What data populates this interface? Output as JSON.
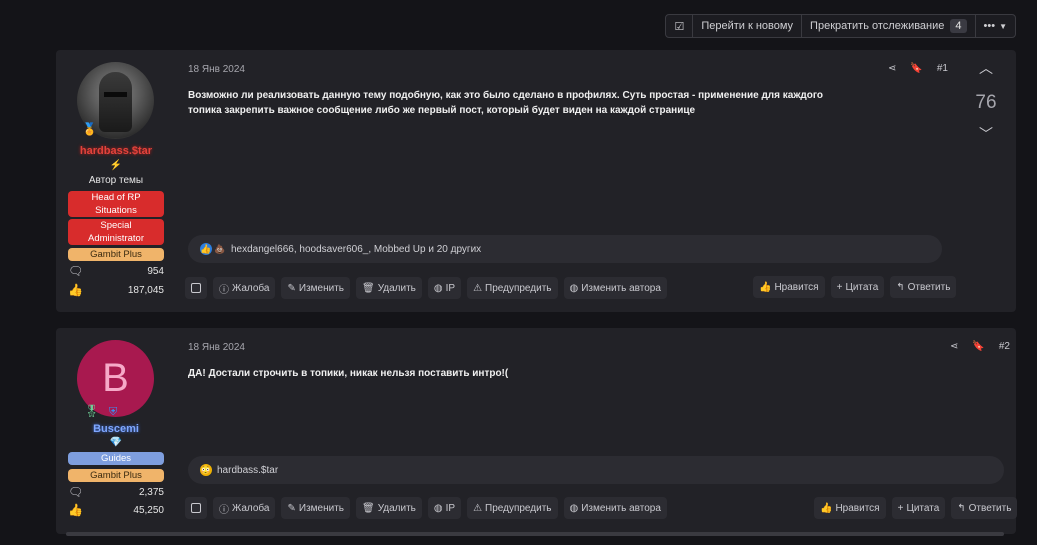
{
  "toolbar": {
    "new_label": "Перейти к новому",
    "unwatch_label": "Прекратить отслеживание",
    "watch_count": "4",
    "more_label": "•••"
  },
  "posts": [
    {
      "author": "hardbass.$tar",
      "topic_author_label": "Автор темы",
      "roles": [
        "Head of RP Situations",
        "Special Administrator",
        "Gambit Plus"
      ],
      "messages": "954",
      "likes": "187,045",
      "date": "18 Янв 2024",
      "number": "#1",
      "text": "Возможно ли реализовать данную тему подобную, как это было сделано в профилях. Суть простая - применение для каждого топика закрепить важное сообщение либо же первый пост, который будет виден на каждой странице",
      "vote_count": "76",
      "reactions_text": "hexdangel666, hoodsaver606_, Mobbed Up и 20 других"
    },
    {
      "author": "Buscemi",
      "avatar_letter": "B",
      "roles": [
        "Guides",
        "Gambit Plus"
      ],
      "messages": "2,375",
      "likes": "45,250",
      "date": "18 Янв 2024",
      "number": "#2",
      "text": "ДА! Достали строчить в топики, никак нельзя поставить интро!(",
      "reactions_text": "hardbass.$tar"
    }
  ],
  "actions": {
    "report": "Жалоба",
    "edit": "Изменить",
    "delete": "Удалить",
    "ip": "IP",
    "warn": "Предупредить",
    "change_author": "Изменить автора",
    "like": "Нравится",
    "quote": "Цитата",
    "reply": "Ответить"
  },
  "colors": {
    "page_bg": "#141418",
    "post_bg": "#222227",
    "name_red": "#e2433c",
    "name_blue": "#7fa7ff",
    "role_red": "#d82c2c",
    "role_gold": "#f0b46a",
    "role_blue": "#7e9ede"
  }
}
